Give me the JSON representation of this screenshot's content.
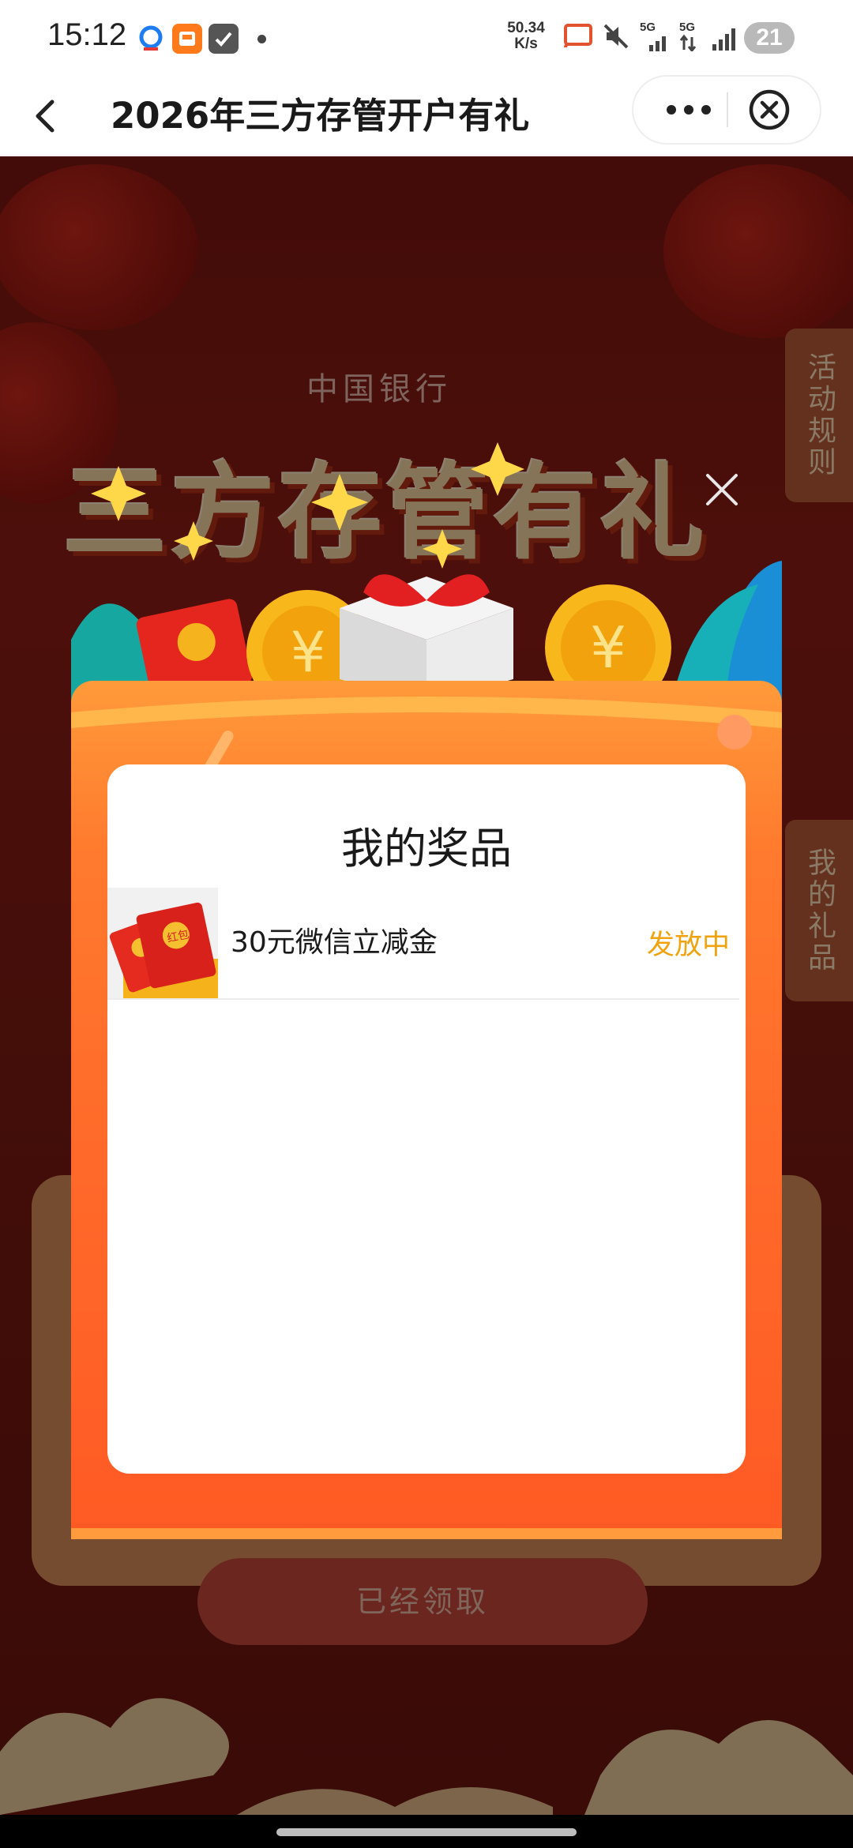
{
  "status_bar": {
    "time": "15:12",
    "net_speed_value": "50.34",
    "net_speed_unit": "K/s",
    "signal_1_label": "5G",
    "signal_2_label": "5G",
    "battery": "21"
  },
  "nav": {
    "title": "2026年三方存管开户有礼"
  },
  "background": {
    "bank_logo_text": "中国银行",
    "headline": "三方存管有礼",
    "rules_tab": "活动规则",
    "gifts_tab": "我的礼品",
    "claim_button": "已经领取"
  },
  "modal": {
    "title": "我的奖品",
    "prizes": [
      {
        "name": "30元微信立减金",
        "status": "发放中",
        "thumb_label": "红包"
      }
    ]
  },
  "colors": {
    "accent_orange": "#ff6a2a",
    "status_yellow": "#f1a30f",
    "page_red": "#8c1d14"
  }
}
